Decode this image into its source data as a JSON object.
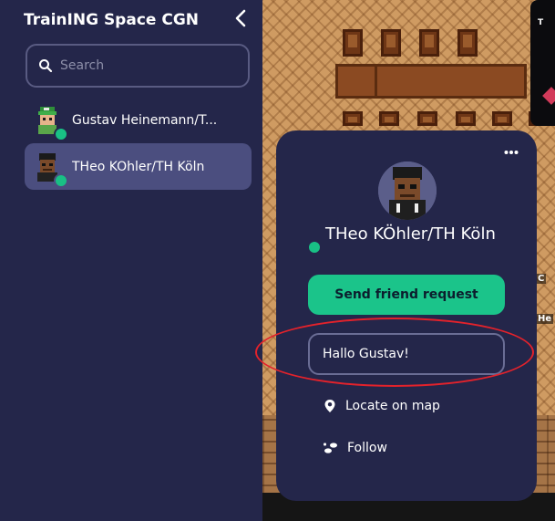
{
  "sidebar": {
    "title": "TrainING Space CGN",
    "search_placeholder": "Search",
    "users": [
      {
        "name": "Gustav Heinemann/T...",
        "status": "online",
        "active": false
      },
      {
        "name": "THeo KÖhler/TH Köln",
        "status": "online",
        "active": true
      }
    ]
  },
  "popup": {
    "name": "THeo KÖhler/TH Köln",
    "friend_button": "Send friend request",
    "message_value": "Hallo Gustav!",
    "actions": {
      "locate": "Locate on map",
      "follow": "Follow"
    }
  },
  "map": {
    "card_label": "T",
    "labels": [
      "He",
      "C"
    ]
  },
  "colors": {
    "sidebar_bg": "#24264a",
    "active_row": "#4b4e7f",
    "accent_green": "#1bc48a",
    "annotation_red": "#e3222b"
  },
  "icons": {
    "collapse": "chevron-left-icon",
    "search": "search-icon",
    "more": "more-horizontal-icon",
    "locate": "map-pin-icon",
    "follow": "footsteps-icon"
  }
}
